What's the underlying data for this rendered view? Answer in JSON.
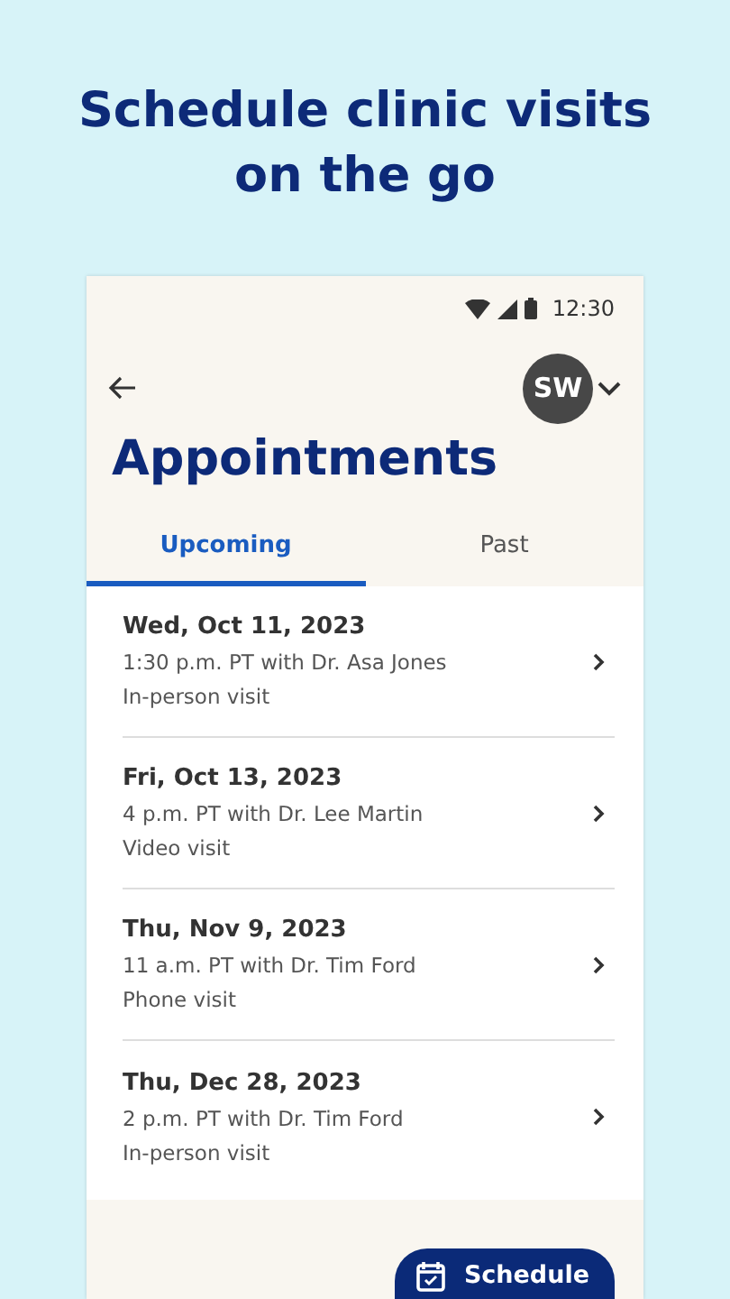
{
  "headline": "Schedule clinic visits on the go",
  "status_bar": {
    "time": "12:30"
  },
  "header": {
    "avatar_initials": "SW",
    "title": "Appointments"
  },
  "tabs": [
    {
      "label": "Upcoming",
      "selected": true
    },
    {
      "label": "Past",
      "selected": false
    }
  ],
  "appointments": [
    {
      "date": "Wed, Oct 11, 2023",
      "time_provider": "1:30 p.m. PT with Dr. Asa Jones",
      "visit_type": "In-person visit"
    },
    {
      "date": "Fri, Oct 13, 2023",
      "time_provider": "4 p.m. PT with Dr. Lee Martin",
      "visit_type": "Video visit"
    },
    {
      "date": "Thu, Nov 9, 2023",
      "time_provider": "11 a.m. PT with Dr. Tim Ford",
      "visit_type": "Phone visit"
    },
    {
      "date": "Thu, Dec 28, 2023",
      "time_provider": "2 p.m. PT with Dr. Tim Ford",
      "visit_type": "In-person visit"
    }
  ],
  "schedule_button": {
    "label": "Schedule"
  }
}
